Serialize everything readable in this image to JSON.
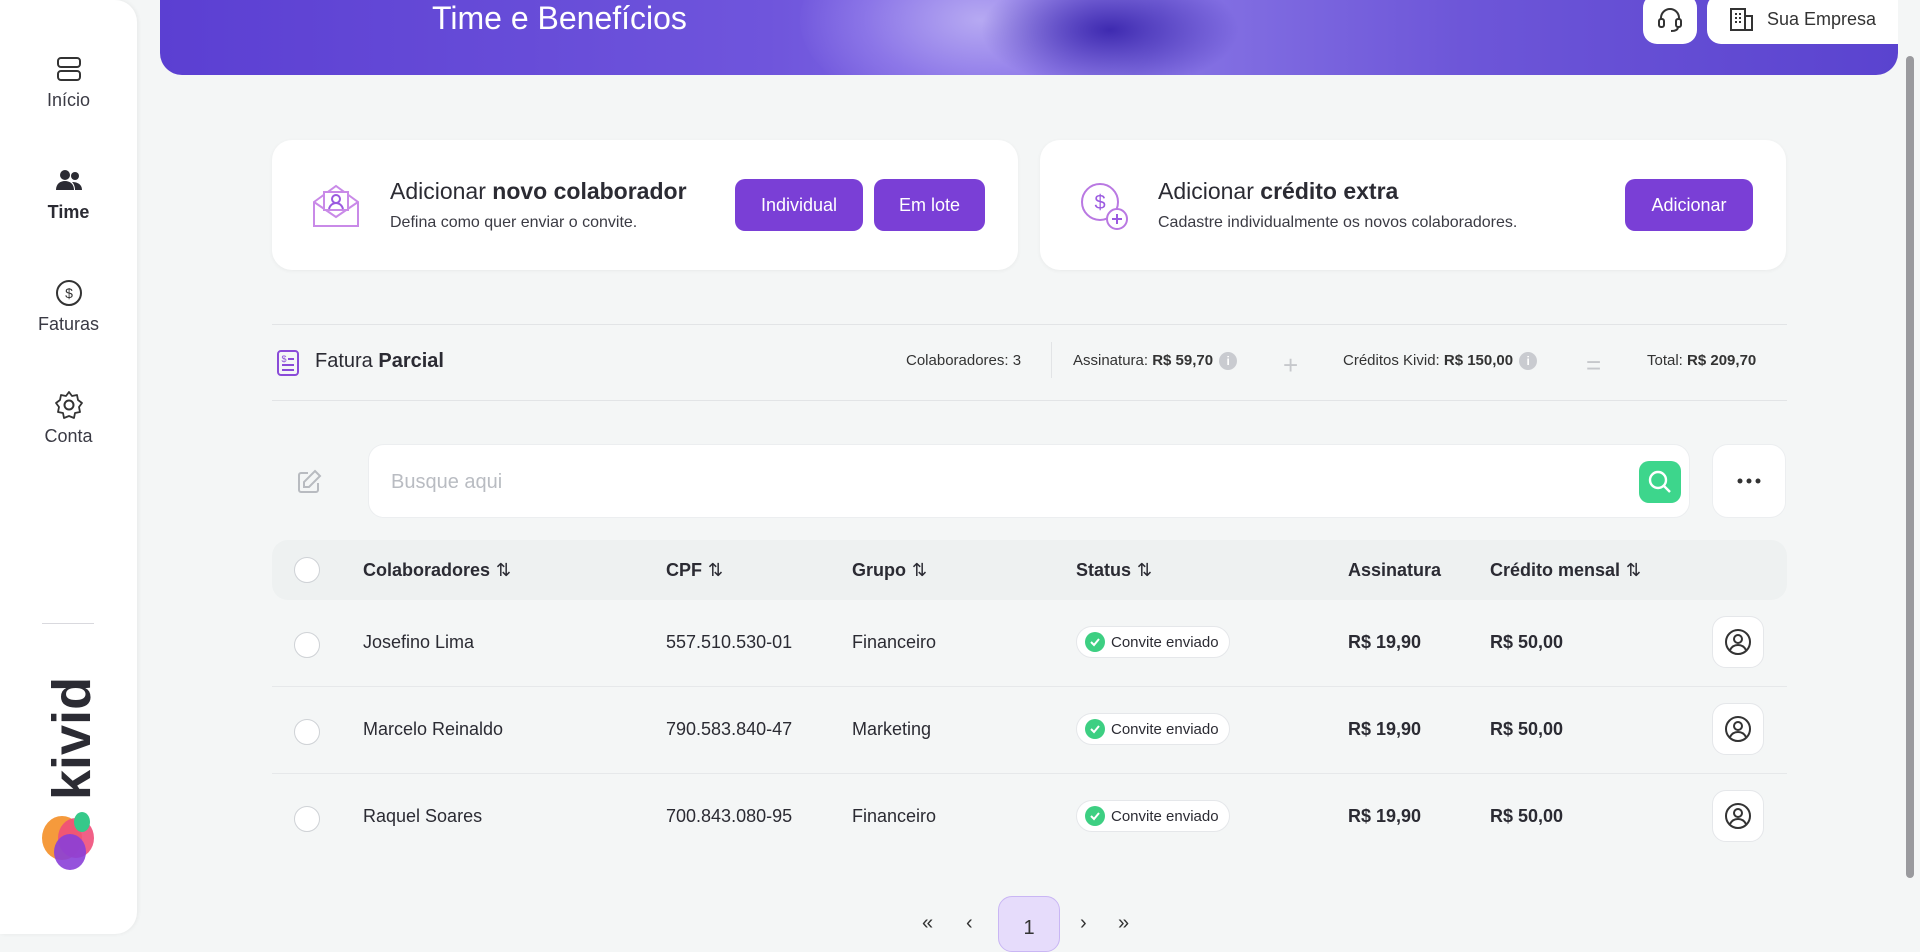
{
  "sidebar": {
    "items": [
      {
        "label": "Início",
        "icon": "home-icon"
      },
      {
        "label": "Time",
        "icon": "team-icon"
      },
      {
        "label": "Faturas",
        "icon": "dollar-icon"
      },
      {
        "label": "Conta",
        "icon": "gear-icon"
      }
    ],
    "active": "Time",
    "brand": "kivid"
  },
  "header": {
    "title": "Time e Benefícios",
    "company": "Sua Empresa"
  },
  "add_collaborator": {
    "title_prefix": "Adicionar",
    "title_bold": "novo colaborador",
    "subtitle": "Defina como quer enviar o convite.",
    "individual_label": "Individual",
    "batch_label": "Em lote"
  },
  "add_credit": {
    "title_prefix": "Adicionar",
    "title_bold": "crédito extra",
    "subtitle": "Cadastre individualmente os novos colaboradores.",
    "add_label": "Adicionar"
  },
  "invoice": {
    "title_prefix": "Fatura",
    "title_bold": "Parcial",
    "collaborators_label": "Colaboradores:",
    "collaborators_value": "3",
    "subscription_label": "Assinatura:",
    "subscription_value": "R$ 59,70",
    "credits_label": "Créditos Kivid:",
    "credits_value": "R$ 150,00",
    "total_label": "Total:",
    "total_value": "R$ 209,70"
  },
  "search": {
    "placeholder": "Busque aqui"
  },
  "table": {
    "columns": [
      "Colaboradores",
      "CPF",
      "Grupo",
      "Status",
      "Assinatura",
      "Crédito mensal"
    ],
    "rows": [
      {
        "name": "Josefino Lima",
        "cpf": "557.510.530-01",
        "group": "Financeiro",
        "status": "Convite enviado",
        "subscription": "R$ 19,90",
        "credit": "R$ 50,00"
      },
      {
        "name": "Marcelo Reinaldo",
        "cpf": "790.583.840-47",
        "group": "Marketing",
        "status": "Convite enviado",
        "subscription": "R$ 19,90",
        "credit": "R$ 50,00"
      },
      {
        "name": "Raquel Soares",
        "cpf": "700.843.080-95",
        "group": "Financeiro",
        "status": "Convite enviado",
        "subscription": "R$ 19,90",
        "credit": "R$ 50,00"
      }
    ]
  },
  "pagination": {
    "first": "«",
    "prev": "‹",
    "current": "1",
    "next": "›",
    "last": "»"
  },
  "colors": {
    "accent": "#7a3fd6",
    "success": "#3dd68c",
    "header_gradient": "#5b3fd2"
  }
}
